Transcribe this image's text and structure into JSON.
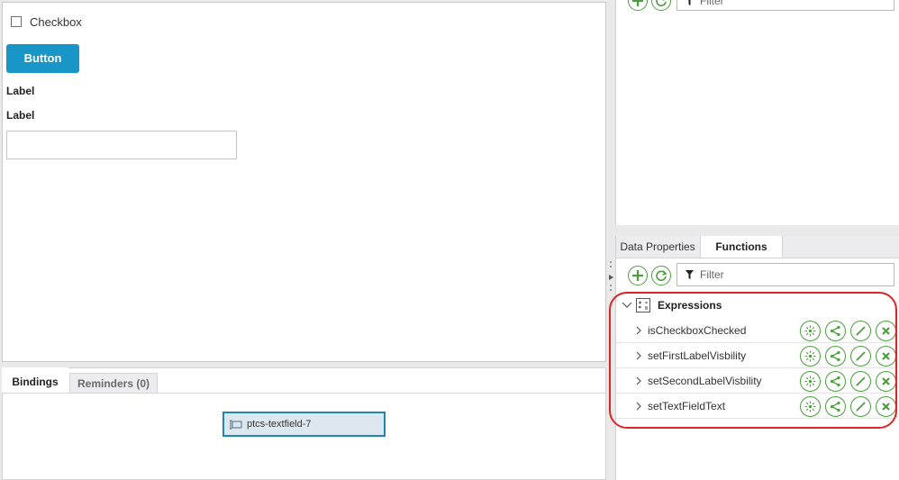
{
  "canvas": {
    "checkbox_label": "Checkbox",
    "button_label": "Button",
    "label_1": "Label",
    "label_2": "Label"
  },
  "bottom_tabs": {
    "bindings": "Bindings",
    "reminders": "Reminders (0)"
  },
  "binding_node": {
    "label": "ptcs-textfield-7"
  },
  "right_top": {
    "filter_placeholder": "Filter"
  },
  "right_tabs": {
    "data_properties": "Data Properties",
    "functions": "Functions"
  },
  "functions_panel": {
    "filter_placeholder": "Filter",
    "group_label": "Expressions",
    "items": [
      {
        "name": "isCheckboxChecked"
      },
      {
        "name": "setFirstLabelVisbility"
      },
      {
        "name": "setSecondLabelVisbility"
      },
      {
        "name": "setTextFieldText"
      }
    ],
    "row_actions": [
      "configure-icon",
      "bind-icon",
      "edit-icon",
      "delete-icon"
    ]
  },
  "colors": {
    "primary_button": "#1896c8",
    "action_green": "#4a9e3c",
    "highlight_red": "#dc2426",
    "binding_border": "#1f86b6"
  }
}
